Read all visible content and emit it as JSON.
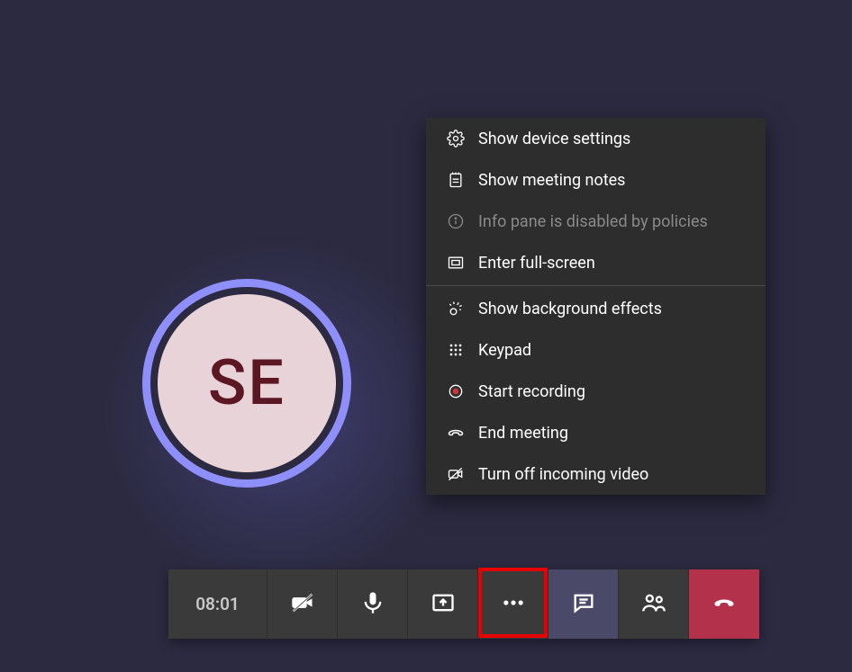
{
  "avatar": {
    "initials": "SE"
  },
  "menu": {
    "device_settings": "Show device settings",
    "meeting_notes": "Show meeting notes",
    "info_pane": "Info pane is disabled by policies",
    "fullscreen": "Enter full-screen",
    "background_effects": "Show background effects",
    "keypad": "Keypad",
    "start_recording": "Start recording",
    "end_meeting": "End meeting",
    "incoming_video_off": "Turn off incoming video"
  },
  "toolbar": {
    "timer": "08:01"
  }
}
